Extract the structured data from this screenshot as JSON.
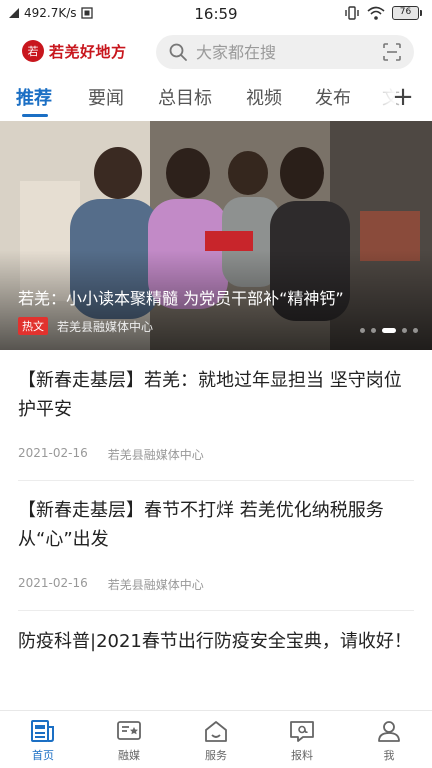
{
  "status_bar": {
    "network_speed": "492.7K/s",
    "time": "16:59",
    "battery": "76"
  },
  "header": {
    "logo_mark": "若",
    "app_name": "若羌好地方",
    "search_placeholder": "大家都在搜"
  },
  "tabs": [
    {
      "label": "推荐",
      "active": true
    },
    {
      "label": "要闻",
      "active": false
    },
    {
      "label": "总目标",
      "active": false
    },
    {
      "label": "视频",
      "active": false
    },
    {
      "label": "发布",
      "active": false
    },
    {
      "label": "文",
      "active": false
    }
  ],
  "banner": {
    "title": "若羌：小小读本聚精髓 为党员干部补“精神钙”",
    "badge": "热文",
    "source": "若羌县融媒体中心"
  },
  "news": [
    {
      "title": "【新春走基层】若羌：就地过年显担当 坚守岗位护平安",
      "date": "2021-02-16",
      "source": "若羌县融媒体中心"
    },
    {
      "title": "【新春走基层】春节不打烊 若羌优化纳税服务 从“心”出发",
      "date": "2021-02-16",
      "source": "若羌县融媒体中心"
    },
    {
      "title": "防疫科普|2021春节出行防疫安全宝典，请收好！",
      "date": "",
      "source": ""
    }
  ],
  "bottom_nav": [
    {
      "label": "首页",
      "icon": "home-news-icon",
      "active": true
    },
    {
      "label": "融媒",
      "icon": "media-icon",
      "active": false
    },
    {
      "label": "服务",
      "icon": "service-house-icon",
      "active": false
    },
    {
      "label": "报料",
      "icon": "report-icon",
      "active": false
    },
    {
      "label": "我",
      "icon": "profile-icon",
      "active": false
    }
  ],
  "colors": {
    "accent": "#1b6fc4",
    "brand": "#c8161d",
    "hot_badge": "#e1322e"
  }
}
